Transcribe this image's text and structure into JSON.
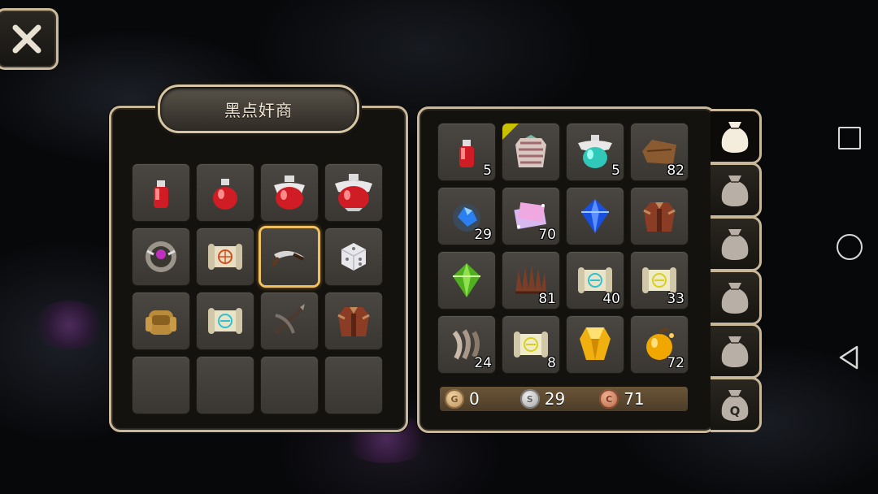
{
  "shop": {
    "title": "黑点奸商",
    "items": [
      {
        "icon": "small-red-potion-icon"
      },
      {
        "icon": "medium-red-potion-icon"
      },
      {
        "icon": "large-red-potion-icon"
      },
      {
        "icon": "huge-red-potion-icon"
      },
      {
        "icon": "magic-orb-icon"
      },
      {
        "icon": "red-scroll-icon"
      },
      {
        "icon": "curved-dagger-icon",
        "selected": true
      },
      {
        "icon": "dice-icon"
      },
      {
        "icon": "leather-backpack-icon"
      },
      {
        "icon": "blue-scroll-icon"
      },
      {
        "icon": "crossbow-icon"
      },
      {
        "icon": "leather-armor-icon"
      },
      {
        "icon": "empty-slot"
      },
      {
        "icon": "empty-slot"
      },
      {
        "icon": "empty-slot"
      },
      {
        "icon": "empty-slot"
      }
    ]
  },
  "inventory": {
    "items": [
      {
        "icon": "small-red-potion-icon",
        "qty": "5"
      },
      {
        "icon": "ornate-armor-icon",
        "qty": "",
        "new": true
      },
      {
        "icon": "teal-potion-icon",
        "qty": "5"
      },
      {
        "icon": "leather-hide-icon",
        "qty": "82"
      },
      {
        "icon": "blue-crystal-ore-icon",
        "qty": "29"
      },
      {
        "icon": "pink-crystal-scroll-icon",
        "qty": "70"
      },
      {
        "icon": "sapphire-gem-icon",
        "qty": ""
      },
      {
        "icon": "leather-armor-icon",
        "qty": ""
      },
      {
        "icon": "emerald-gem-icon",
        "qty": ""
      },
      {
        "icon": "spiky-fur-icon",
        "qty": "81"
      },
      {
        "icon": "blue-scroll-icon",
        "qty": "40"
      },
      {
        "icon": "yellow-scroll-icon",
        "qty": "33"
      },
      {
        "icon": "claw-fragments-icon",
        "qty": "24"
      },
      {
        "icon": "yellow-scroll-icon",
        "qty": "8"
      },
      {
        "icon": "topaz-gem-icon",
        "qty": ""
      },
      {
        "icon": "golden-apple-icon",
        "qty": "72"
      }
    ]
  },
  "currency": {
    "gold": "0",
    "silver": "29",
    "copper": "71"
  },
  "bag_tabs": [
    {
      "label": "",
      "active": true
    },
    {
      "label": "",
      "active": false
    },
    {
      "label": "",
      "active": false
    },
    {
      "label": "",
      "active": false
    },
    {
      "label": "",
      "active": false
    },
    {
      "label": "Q",
      "active": false
    }
  ]
}
